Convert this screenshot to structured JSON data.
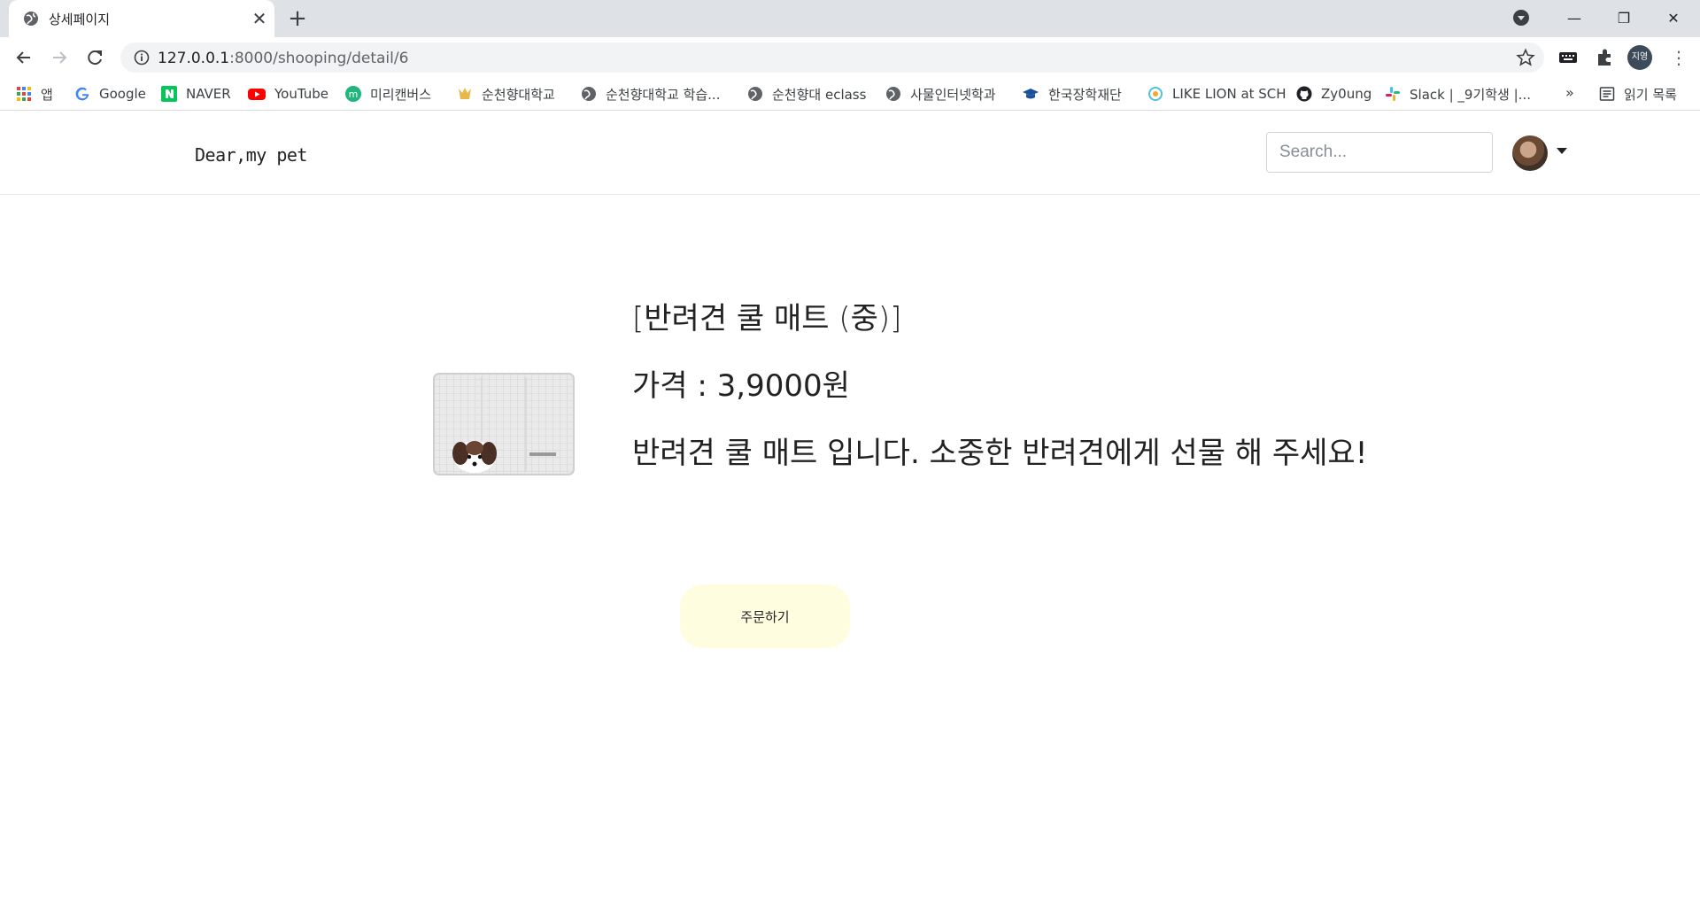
{
  "browser": {
    "tab_title": "상세페이지",
    "url_host": "127.0.0.1",
    "url_rest": ":8000/shooping/detail/6",
    "profile_initials": "지영",
    "bookmarks": [
      {
        "label": "앱",
        "icon": "apps-grid-icon"
      },
      {
        "label": "Google",
        "icon": "google-icon"
      },
      {
        "label": "NAVER",
        "icon": "naver-icon"
      },
      {
        "label": "YouTube",
        "icon": "youtube-icon"
      },
      {
        "label": "미리캔버스",
        "icon": "miricanvas-icon"
      },
      {
        "label": "순천향대학교",
        "icon": "university-icon"
      },
      {
        "label": "순천향대학교 학습...",
        "icon": "globe-icon"
      },
      {
        "label": "순천향대 eclass",
        "icon": "globe-icon"
      },
      {
        "label": "사물인터넷학과",
        "icon": "globe-icon"
      },
      {
        "label": "한국장학재단",
        "icon": "graduation-cap-icon"
      },
      {
        "label": "LIKE LION at SCH",
        "icon": "likelion-icon"
      },
      {
        "label": "Zy0ung",
        "icon": "github-icon"
      },
      {
        "label": "Slack | _9기학생 |...",
        "icon": "slack-icon"
      }
    ],
    "more_label": "»",
    "reading_list_label": "읽기 목록"
  },
  "site": {
    "brand": "Dear,my pet",
    "search_placeholder": "Search..."
  },
  "product": {
    "name": "[반려견 쿨 매트 (중)]",
    "price": "가격 : 3,9000원",
    "description": "반려견 쿨 매트 입니다. 소중한 반려견에게 선물 해 주세요!",
    "order_label": "주문하기"
  },
  "colors": {
    "order_button_bg": "#fffde0",
    "chrome_tabbar": "#dee1e6"
  }
}
